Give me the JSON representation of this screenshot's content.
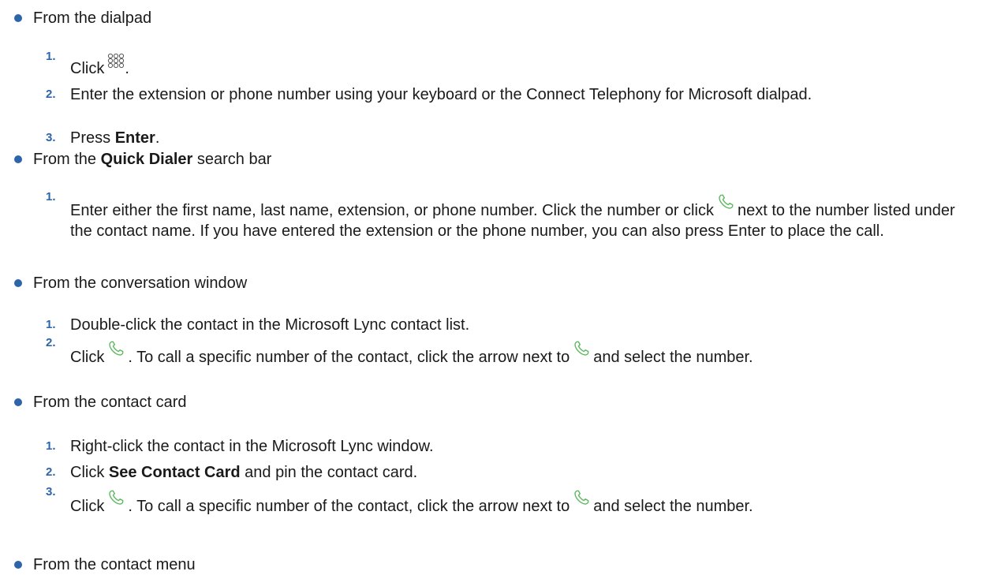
{
  "sections": [
    {
      "heading": "From the dialpad",
      "steps": [
        {
          "num": "1.",
          "t1": "Click",
          "t2": "."
        },
        {
          "num": "2.",
          "text": "Enter the extension or phone number using your keyboard or the Connect Telephony for Microsoft dialpad."
        },
        {
          "num": "3.",
          "t1": "Press ",
          "bold": "Enter",
          "t2": "."
        }
      ]
    },
    {
      "h1": "From the ",
      "hbold": "Quick Dialer",
      "h2": " search bar",
      "steps": [
        {
          "num": "1.",
          "t1": "Enter either the first name, last name, extension, or phone number. Click the number or click",
          "t2": "next to the number listed under the contact name. If you have entered the extension or the phone number, you can also press Enter to place the call."
        }
      ]
    },
    {
      "heading": "From the conversation window",
      "steps": [
        {
          "num": "1.",
          "text": "Double-click the contact in the Microsoft Lync contact list."
        },
        {
          "num": "2.",
          "t1": "Click",
          "t2": ". To call a specific number of the contact, click the arrow next to",
          "t3": "and select the number."
        }
      ]
    },
    {
      "heading": "From the contact card",
      "steps": [
        {
          "num": "1.",
          "text": "Right-click the contact in the Microsoft Lync window."
        },
        {
          "num": "2.",
          "t1": "Click ",
          "bold": "See Contact Card",
          "t2": " and pin the contact card."
        },
        {
          "num": "3.",
          "t1": "Click",
          "t2": ". To call a specific number of the contact, click the arrow next to",
          "t3": "and select the number."
        }
      ]
    },
    {
      "heading": "From the contact menu"
    }
  ],
  "icons": {
    "dialpad": "dialpad-icon",
    "phone": "phone-call-icon"
  },
  "colors": {
    "numbering": "#2e64a8",
    "phone_icon": "#5cb85c"
  }
}
